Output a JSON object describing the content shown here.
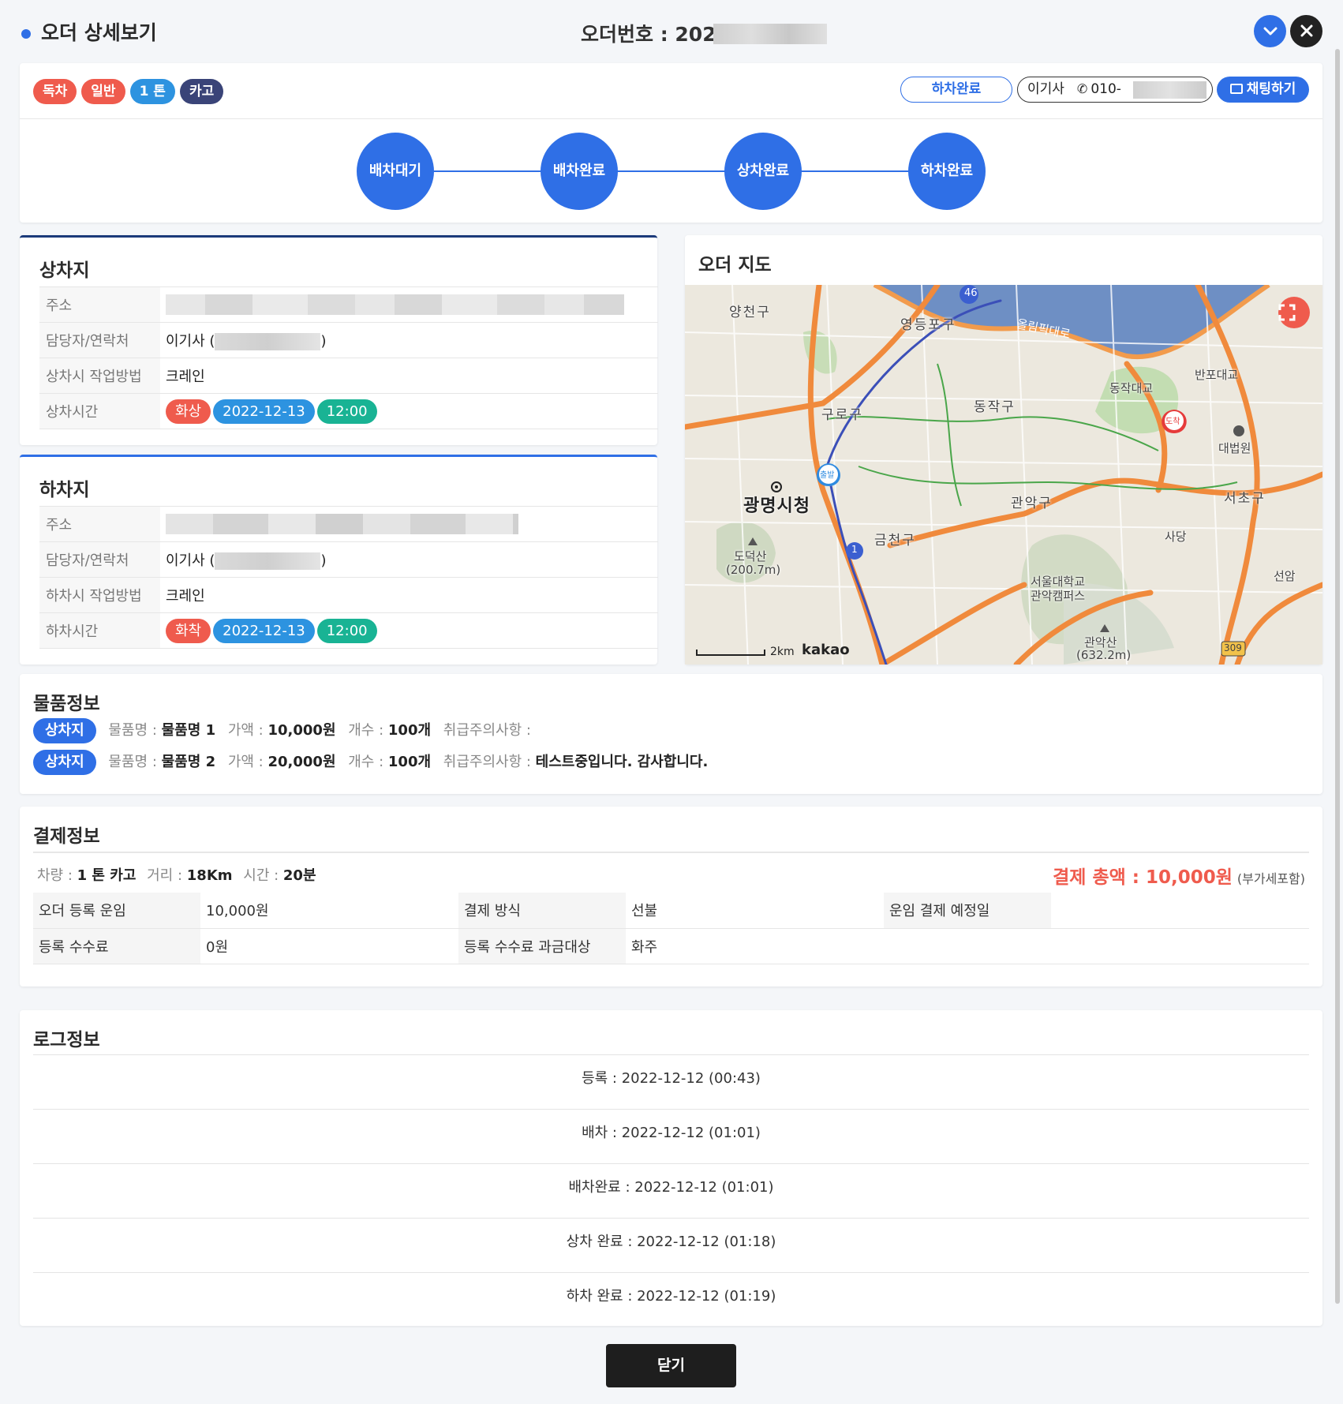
{
  "header": {
    "title": "오더 상세보기",
    "order_no": "오더번호 : 2022"
  },
  "tags": [
    "독차",
    "일반",
    "1 톤",
    "카고"
  ],
  "status_pill": "하차완료",
  "driver": {
    "name": "이기사",
    "phone": "010-"
  },
  "chat_label": "채팅하기",
  "steps": [
    "배차대기",
    "배차완료",
    "상차완료",
    "하차완료"
  ],
  "pickup": {
    "title": "상차지",
    "rows": {
      "address": "주소",
      "contact": "담당자/연락처",
      "method": "상차시 작업방법",
      "time": "상차시간"
    },
    "contact_name": "이기사 (",
    "contact_close": ")",
    "method_value": "크레인",
    "time_type": "화상",
    "date": "2022-12-13",
    "hour": "12:00"
  },
  "drop": {
    "title": "하차지",
    "rows": {
      "address": "주소",
      "contact": "담당자/연락처",
      "method": "하차시 작업방법",
      "time": "하차시간"
    },
    "contact_name": "이기사 (",
    "contact_close": ")",
    "method_value": "크레인",
    "time_type": "화착",
    "date": "2022-12-13",
    "hour": "12:00"
  },
  "map": {
    "title": "오더 지도",
    "labels": {
      "yangcheon": "양천구",
      "yeongdeungpo": "영등포구",
      "guro": "구로구",
      "dongjak": "동작구",
      "gwangmyeong": "광명시청",
      "gwanak": "관악구",
      "seocho": "서초구",
      "geumcheon": "금천구",
      "dodeoksan": "도덕산",
      "dodeoksan_h": "(200.7m)",
      "snu1": "서울대학교",
      "snu2": "관악캠퍼스",
      "gwanaksan": "관악산",
      "gwanaksan_h": "(632.2m)",
      "sadang": "사당",
      "court": "대법원",
      "dongjak_bridge": "동작대교",
      "banpo_bridge": "반포대교",
      "olympic": "올림픽대로",
      "seoam": "선암",
      "route46": "46",
      "route1": "1",
      "route309": "309",
      "start_pin": "출발",
      "end_pin": "도착",
      "scale": "2km",
      "brand": "kakao"
    }
  },
  "goods": {
    "title": "물품정보",
    "items": [
      {
        "badge": "상차지",
        "name_label": "물품명 :",
        "name": "물품명 1",
        "price_label": "가액 :",
        "price": "10,000원",
        "qty_label": "개수 :",
        "qty": "100개",
        "note_label": "취급주의사항 :",
        "note": ""
      },
      {
        "badge": "상차지",
        "name_label": "물품명 :",
        "name": "물품명 2",
        "price_label": "가액 :",
        "price": "20,000원",
        "qty_label": "개수 :",
        "qty": "100개",
        "note_label": "취급주의사항 :",
        "note": "테스트중입니다. 감사합니다."
      }
    ]
  },
  "payment": {
    "title": "결제정보",
    "vehicle_label": "차량 :",
    "vehicle": "1 톤 카고",
    "distance_label": "거리 :",
    "distance": "18Km",
    "time_label": "시간 :",
    "time": "20분",
    "total_label": "결제 총액 : 10,000원",
    "total_note": "(부가세포함)",
    "rows": [
      [
        "오더 등록 운임",
        "10,000원",
        "결제 방식",
        "선불",
        "운임 결제 예정일",
        ""
      ],
      [
        "등록 수수료",
        "0원",
        "등록 수수료 과금대상",
        "화주",
        "",
        ""
      ]
    ]
  },
  "log": {
    "title": "로그정보",
    "items": [
      "등록 : 2022-12-12 (00:43)",
      "배차 : 2022-12-12 (01:01)",
      "배차완료 : 2022-12-12 (01:01)",
      "상차 완료 : 2022-12-12 (01:18)",
      "하차 완료 : 2022-12-12 (01:19)"
    ]
  },
  "footer": {
    "close_label": "닫기"
  },
  "colors": {
    "primary": "#2f6fe6",
    "danger": "#ef5b4d",
    "info": "#2d93e0",
    "navy": "#3a4478",
    "success": "#19b394"
  }
}
